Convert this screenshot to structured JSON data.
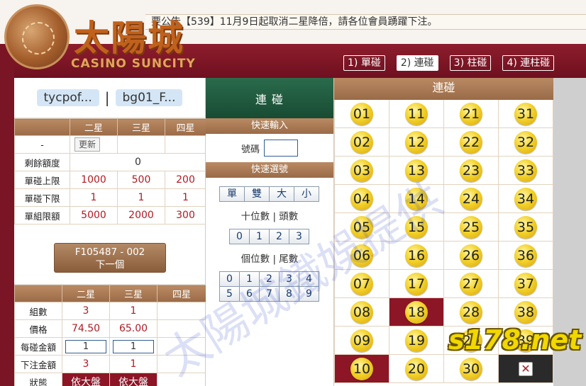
{
  "announcement": "要公告【539】11月9日起取消二星降倍，請各位會員踴躍下注。",
  "logo": {
    "cn": "太陽城",
    "en": "CASINO SUNCITY"
  },
  "mode_tabs": [
    {
      "label": "1) 單碰"
    },
    {
      "label": "2) 連碰"
    },
    {
      "label": "3) 柱碰"
    },
    {
      "label": "4) 連柱碰"
    }
  ],
  "users": {
    "user1": "tycpof...",
    "sep": "|",
    "user2": "bg01_F..."
  },
  "limits_table": {
    "headers": [
      "",
      "二星",
      "三星",
      "四星"
    ],
    "dash": "-",
    "refresh_label": "更新",
    "rows": [
      {
        "label": "剩餘額度",
        "value": "0"
      },
      {
        "label": "單碰上限",
        "values": [
          "1000",
          "500",
          "200"
        ]
      },
      {
        "label": "單碰下限",
        "values": [
          "1",
          "1",
          "1"
        ]
      },
      {
        "label": "單組限額",
        "values": [
          "5000",
          "2000",
          "300"
        ]
      }
    ]
  },
  "ticket": {
    "id": "F105487 - 002",
    "next": "下一個"
  },
  "bet_table": {
    "headers": [
      "",
      "二星",
      "三星",
      "四星"
    ],
    "group_label": "組數",
    "group_values": [
      "3",
      "1",
      ""
    ],
    "price_label": "價格",
    "price_values": [
      "74.50",
      "65.00",
      ""
    ],
    "amount_label": "每碰金額",
    "amount_values": [
      "1",
      "1"
    ],
    "total_label": "下注金額",
    "total_values": [
      "3",
      "1",
      ""
    ],
    "status_label": "狀態",
    "status_values": [
      "依大盤",
      "依大盤"
    ]
  },
  "middle": {
    "title": "連 碰",
    "quick_input": "快速輸入",
    "number_label": "號碼",
    "quick_select": "快速選號",
    "type_buttons": [
      "單",
      "雙",
      "大",
      "小"
    ],
    "tens_label": "十位數 | 頭數",
    "tens_buttons": [
      "0",
      "1",
      "2",
      "3"
    ],
    "ones_label": "個位數 | 尾數",
    "ones_buttons": [
      "0",
      "1",
      "2",
      "3",
      "4",
      "5",
      "6",
      "7",
      "8",
      "9"
    ]
  },
  "grid": {
    "title": "連碰",
    "cells": [
      {
        "n": "01",
        "sel": false
      },
      {
        "n": "11",
        "sel": false
      },
      {
        "n": "21",
        "sel": false
      },
      {
        "n": "31",
        "sel": false
      },
      {
        "n": "02",
        "sel": false
      },
      {
        "n": "12",
        "sel": false
      },
      {
        "n": "22",
        "sel": false
      },
      {
        "n": "32",
        "sel": false
      },
      {
        "n": "03",
        "sel": false
      },
      {
        "n": "13",
        "sel": false
      },
      {
        "n": "23",
        "sel": false
      },
      {
        "n": "33",
        "sel": false
      },
      {
        "n": "04",
        "sel": false
      },
      {
        "n": "14",
        "sel": false
      },
      {
        "n": "24",
        "sel": false
      },
      {
        "n": "34",
        "sel": false
      },
      {
        "n": "05",
        "sel": false
      },
      {
        "n": "15",
        "sel": false
      },
      {
        "n": "25",
        "sel": false
      },
      {
        "n": "35",
        "sel": false
      },
      {
        "n": "06",
        "sel": false
      },
      {
        "n": "16",
        "sel": false
      },
      {
        "n": "26",
        "sel": false
      },
      {
        "n": "36",
        "sel": false
      },
      {
        "n": "07",
        "sel": false
      },
      {
        "n": "17",
        "sel": false
      },
      {
        "n": "27",
        "sel": false
      },
      {
        "n": "37",
        "sel": false
      },
      {
        "n": "08",
        "sel": false
      },
      {
        "n": "18",
        "sel": true
      },
      {
        "n": "28",
        "sel": false
      },
      {
        "n": "38",
        "sel": false
      },
      {
        "n": "09",
        "sel": false
      },
      {
        "n": "19",
        "sel": false
      },
      {
        "n": "29",
        "sel": false
      },
      {
        "n": "39",
        "sel": false
      },
      {
        "n": "10",
        "sel": true
      },
      {
        "n": "20",
        "sel": false
      },
      {
        "n": "30",
        "sel": false
      },
      {
        "n": "cancel",
        "sel": false
      }
    ],
    "cancel_icon": "close-icon"
  },
  "watermark": "太陽城鐵娛提供",
  "site_mark": "s178.net",
  "colors": {
    "maroon": "#8c1526",
    "brown": "#9a6b47",
    "green": "#184b33",
    "ball": "#f3d22b"
  }
}
